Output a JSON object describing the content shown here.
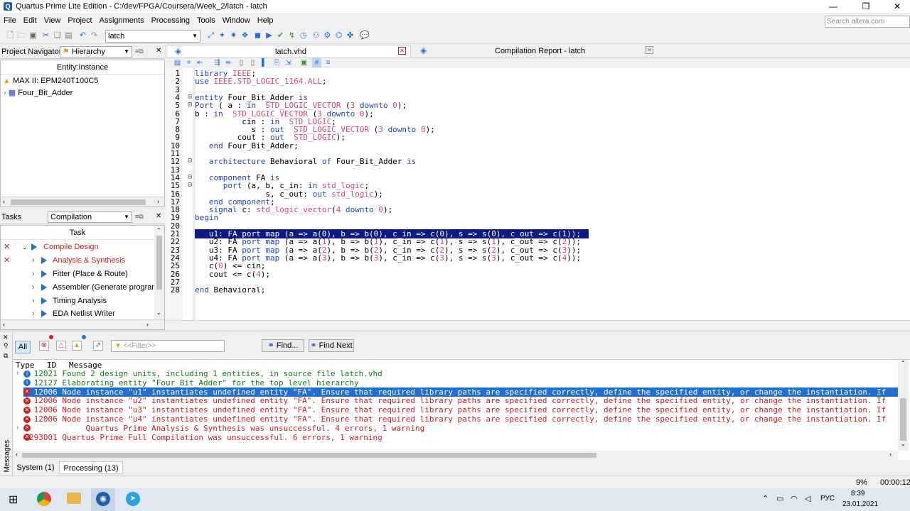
{
  "window": {
    "title": "Quartus Prime Lite Edition - C:/dev/FPGA/Coursera/Week_2/latch - latch"
  },
  "menu": [
    "File",
    "Edit",
    "View",
    "Project",
    "Assignments",
    "Processing",
    "Tools",
    "Window",
    "Help"
  ],
  "toolbar": {
    "revision": "latch",
    "search_placeholder": "Search altera.com"
  },
  "navigator": {
    "title": "Project Navigator",
    "view": "Hierarchy",
    "column": "Entity:Instance",
    "device": "MAX II: EPM240T100C5",
    "entity": "Four_Bit_Adder"
  },
  "tasks": {
    "title": "Tasks",
    "flow": "Compilation",
    "column": "Task",
    "items": [
      {
        "label": "Compile Design",
        "status": "error"
      },
      {
        "label": "Analysis & Synthesis",
        "status": "error"
      },
      {
        "label": "Fitter (Place & Route)",
        "status": ""
      },
      {
        "label": "Assembler (Generate programn",
        "status": ""
      },
      {
        "label": "Timing Analysis",
        "status": ""
      },
      {
        "label": "EDA Netlist Writer",
        "status": ""
      }
    ]
  },
  "tabs": {
    "editor": "latch.vhd",
    "report": "Compilation Report - latch"
  },
  "code": [
    "library IEEE;",
    "use IEEE.STD_LOGIC_1164.ALL;",
    "",
    "entity Four_Bit_Adder is",
    "Port ( a : in  STD_LOGIC_VECTOR (3 downto 0);",
    "b : in  STD_LOGIC_VECTOR (3 downto 0);",
    "          cin : in  STD_LOGIC;",
    "            s : out  STD_LOGIC_VECTOR (3 downto 0);",
    "         cout : out  STD_LOGIC);",
    "   end Four_Bit_Adder;",
    "",
    "   architecture Behavioral of Four_Bit_Adder is",
    "",
    "   component FA is",
    "      port (a, b, c_in: in std_logic;",
    "               s, c_out: out std_logic);",
    "   end component;",
    "   signal c: std_logic_vector(4 downto 0);",
    "begin",
    "",
    "   u1: FA port map (a => a(0), b => b(0), c_in => c(0), s => s(0), c_out => c(1));",
    "   u2: FA port map (a => a(1), b => b(1), c_in => c(1), s => s(1), c_out => c(2));",
    "   u3: FA port map (a => a(2), b => b(2), c_in => c(2), s => s(2), c_out => c(3));",
    "   u4: FA port map (a => a(3), b => b(3), c_in => c(3), s => s(3), c_out => c(4));",
    "   c(0) <= cin;",
    "   cout <= c(4);",
    "",
    "end Behavioral;"
  ],
  "messages": {
    "filter_placeholder": "<<Filter>>",
    "all_label": "All",
    "find_label": "Find...",
    "find_next_label": "Find Next",
    "headers": [
      "Type",
      "ID",
      "Message"
    ],
    "rows": [
      {
        "type": "info",
        "id": "12021",
        "text": "Found 2 design units, including 1 entities, in source file latch.vhd"
      },
      {
        "type": "info",
        "id": "12127",
        "text": "Elaborating entity \"Four_Bit_Adder\" for the top level hierarchy"
      },
      {
        "type": "error",
        "id": "12006",
        "text": "Node instance \"u1\" instantiates undefined entity \"FA\". Ensure that required library paths are specified correctly, define the specified entity, or change the instantiation. If"
      },
      {
        "type": "error",
        "id": "12006",
        "text": "Node instance \"u2\" instantiates undefined entity \"FA\". Ensure that required library paths are specified correctly, define the specified entity, or change the instantiation. If"
      },
      {
        "type": "error",
        "id": "12006",
        "text": "Node instance \"u3\" instantiates undefined entity \"FA\". Ensure that required library paths are specified correctly, define the specified entity, or change the instantiation. If"
      },
      {
        "type": "error",
        "id": "12006",
        "text": "Node instance \"u4\" instantiates undefined entity \"FA\". Ensure that required library paths are specified correctly, define the specified entity, or change the instantiation. If"
      },
      {
        "type": "error",
        "id": "",
        "text": "     Quartus Prime Analysis & Synthesis was unsuccessful. 4 errors, 1 warning"
      },
      {
        "type": "error",
        "id": "293001",
        "text": "Quartus Prime Full Compilation was unsuccessful. 6 errors, 1 warning"
      }
    ],
    "tab_system": "System (1)",
    "tab_processing": "Processing (13)",
    "side_label": "Messages"
  },
  "status": {
    "progress": "9%",
    "elapsed": "00:00:12"
  },
  "taskbar": {
    "lang": "РУС",
    "time": "8:39",
    "date": "23.01.2021"
  },
  "colors": {
    "accent": "#1f6fd6",
    "error": "#d51b1b",
    "info": "#157a15",
    "selection": "#0c1a88"
  }
}
